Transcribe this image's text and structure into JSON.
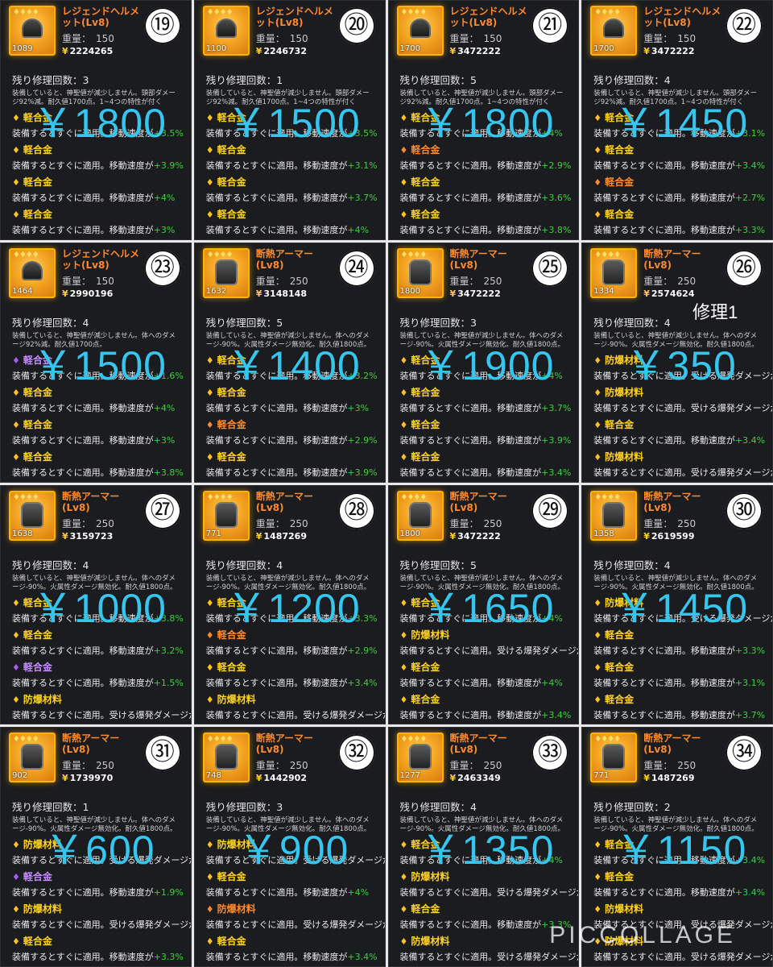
{
  "watermark": "PICCOLLAGE",
  "tiles": [
    {
      "num": "⑲",
      "name": "レジェンドヘルメット(Lv8)",
      "type": "helm",
      "stars": "♦♦♦♦",
      "dur": "1089",
      "weight_label": "重量：",
      "weight": "150",
      "price": "2224265",
      "repair": "残り修理回数：3",
      "desc": "装備していると、神聖値が減少しません。頭部ダメージ92%減。耐久値1700点。1~4つの特性が付く",
      "big": "￥1800",
      "stats": [
        {
          "n": "軽合金",
          "d": "装備するとすぐに適用。移動速度が",
          "v": "+3.5%",
          "c": "y"
        },
        {
          "n": "軽合金",
          "d": "装備するとすぐに適用。移動速度が",
          "v": "+3.9%",
          "c": "y"
        },
        {
          "n": "軽合金",
          "d": "装備するとすぐに適用。移動速度が",
          "v": "+4%",
          "c": "y"
        },
        {
          "n": "軽合金",
          "d": "装備するとすぐに適用。移動速度が",
          "v": "+3%",
          "c": "y"
        }
      ]
    },
    {
      "num": "⑳",
      "name": "レジェンドヘルメット(Lv8)",
      "type": "helm",
      "stars": "♦♦♦♦",
      "dur": "1100",
      "weight_label": "重量：",
      "weight": "150",
      "price": "2246732",
      "repair": "残り修理回数：1",
      "desc": "装備していると、神聖値が減少しません。頭部ダメージ92%減。耐久値1700点。1~4つの特性が付く",
      "big": "￥1500",
      "stats": [
        {
          "n": "軽合金",
          "d": "装備するとすぐに適用。移動速度が",
          "v": "+3.5%",
          "c": "y"
        },
        {
          "n": "軽合金",
          "d": "装備するとすぐに適用。移動速度が",
          "v": "+3.1%",
          "c": "y"
        },
        {
          "n": "軽合金",
          "d": "装備するとすぐに適用。移動速度が",
          "v": "+3.7%",
          "c": "y"
        },
        {
          "n": "軽合金",
          "d": "装備するとすぐに適用。移動速度が",
          "v": "+4%",
          "c": "y"
        }
      ]
    },
    {
      "num": "㉑",
      "name": "レジェンドヘルメット(Lv8)",
      "type": "helm",
      "stars": "♦♦♦♦",
      "dur": "1700",
      "weight_label": "重量：",
      "weight": "150",
      "price": "3472222",
      "repair": "残り修理回数：5",
      "desc": "装備していると、神聖値が減少しません。頭部ダメージ92%減。耐久値1700点。1~4つの特性が付く",
      "big": "￥1800",
      "stats": [
        {
          "n": "軽合金",
          "d": "装備するとすぐに適用。移動速度が",
          "v": "+4%",
          "c": "y"
        },
        {
          "n": "軽合金",
          "d": "装備するとすぐに適用。移動速度が",
          "v": "+2.9%",
          "c": "o"
        },
        {
          "n": "軽合金",
          "d": "装備するとすぐに適用。移動速度が",
          "v": "+3.6%",
          "c": "y"
        },
        {
          "n": "軽合金",
          "d": "装備するとすぐに適用。移動速度が",
          "v": "+3.8%",
          "c": "y"
        }
      ]
    },
    {
      "num": "㉒",
      "name": "レジェンドヘルメット(Lv8)",
      "type": "helm",
      "stars": "♦♦♦♦",
      "dur": "1700",
      "weight_label": "重量：",
      "weight": "150",
      "price": "3472222",
      "repair": "残り修理回数：4",
      "desc": "装備していると、神聖値が減少しません。頭部ダメージ92%減。耐久値1700点。1~4つの特性が付く",
      "big": "￥1450",
      "stats": [
        {
          "n": "軽合金",
          "d": "装備するとすぐに適用。移動速度が",
          "v": "+3.1%",
          "c": "y"
        },
        {
          "n": "軽合金",
          "d": "装備するとすぐに適用。移動速度が",
          "v": "+3.4%",
          "c": "y"
        },
        {
          "n": "軽合金",
          "d": "装備するとすぐに適用。移動速度が",
          "v": "+2.7%",
          "c": "o"
        },
        {
          "n": "軽合金",
          "d": "装備するとすぐに適用。移動速度が",
          "v": "+3.3%",
          "c": "y"
        }
      ]
    },
    {
      "num": "㉓",
      "name": "レジェンドヘルメット(Lv8)",
      "type": "helm",
      "stars": "♦♦♦♦",
      "dur": "1464",
      "weight_label": "重量：",
      "weight": "150",
      "price": "2990196",
      "repair": "残り修理回数：4",
      "desc": "装備していると、神聖値が減少しません。体へのダメージ92%減。耐久値1700点。",
      "big": "￥1500",
      "stats": [
        {
          "n": "軽合金",
          "d": "装備するとすぐに適用。移動速度が",
          "v": "+1.6%",
          "c": "p"
        },
        {
          "n": "軽合金",
          "d": "装備するとすぐに適用。移動速度が",
          "v": "+4%",
          "c": "y"
        },
        {
          "n": "軽合金",
          "d": "装備するとすぐに適用。移動速度が",
          "v": "+3%",
          "c": "y"
        },
        {
          "n": "軽合金",
          "d": "装備するとすぐに適用。移動速度が",
          "v": "+3.8%",
          "c": "y"
        }
      ]
    },
    {
      "num": "㉔",
      "name": "断熱アーマー(Lv8)",
      "type": "armor",
      "stars": "♦♦♦♦",
      "dur": "1632",
      "weight_label": "重量：",
      "weight": "250",
      "price": "3148148",
      "repair": "残り修理回数：5",
      "desc": "装備していると、神聖値が減少しません。体へのダメージ-90%。火属性ダメージ無効化。耐久値1800点。",
      "big": "￥1400",
      "stats": [
        {
          "n": "軽合金",
          "d": "装備するとすぐに適用。移動速度が",
          "v": "+3.2%",
          "c": "y"
        },
        {
          "n": "軽合金",
          "d": "装備するとすぐに適用。移動速度が",
          "v": "+3%",
          "c": "y"
        },
        {
          "n": "軽合金",
          "d": "装備するとすぐに適用。移動速度が",
          "v": "+2.9%",
          "c": "o"
        },
        {
          "n": "軽合金",
          "d": "装備するとすぐに適用。移動速度が",
          "v": "+3.9%",
          "c": "y"
        }
      ]
    },
    {
      "num": "㉕",
      "name": "断熱アーマー(Lv8)",
      "type": "armor",
      "stars": "♦♦♦♦",
      "dur": "1800",
      "weight_label": "重量：",
      "weight": "250",
      "price": "3472222",
      "repair": "残り修理回数：3",
      "desc": "装備していると、神聖値が減少しません。体へのダメージ-90%。火属性ダメージ無効化。耐久値1800点。",
      "big": "￥1900",
      "stats": [
        {
          "n": "軽合金",
          "d": "装備するとすぐに適用。移動速度が",
          "v": "+4%",
          "c": "y"
        },
        {
          "n": "軽合金",
          "d": "装備するとすぐに適用。移動速度が",
          "v": "+3.7%",
          "c": "y"
        },
        {
          "n": "軽合金",
          "d": "装備するとすぐに適用。移動速度が",
          "v": "+3.9%",
          "c": "y"
        },
        {
          "n": "軽合金",
          "d": "装備するとすぐに適用。移動速度が",
          "v": "+3.4%",
          "c": "y"
        }
      ]
    },
    {
      "num": "㉖",
      "name": "断熱アーマー(Lv8)",
      "type": "armor",
      "stars": "♦♦♦♦",
      "dur": "1334",
      "weight_label": "重量：",
      "weight": "250",
      "price": "2574624",
      "repair": "残り修理回数：4",
      "note": "修理1",
      "desc": "装備していると、神聖値が減少しません。体へのダメージ-90%。火属性ダメージ無効化。耐久値1800点。",
      "big": "￥350",
      "stats": [
        {
          "n": "防爆材料",
          "d": "装備するとすぐに適用。受ける爆発ダメージが",
          "v": "-19.2%",
          "c": "y"
        },
        {
          "n": "防爆材料",
          "d": "装備するとすぐに適用。受ける爆発ダメージが",
          "v": "-19.2%",
          "c": "y"
        },
        {
          "n": "軽合金",
          "d": "装備するとすぐに適用。移動速度が",
          "v": "+3.4%",
          "c": "y"
        },
        {
          "n": "防爆材料",
          "d": "装備するとすぐに適用。受ける爆発ダメージが",
          "v": "-25%",
          "c": "y"
        }
      ]
    },
    {
      "num": "㉗",
      "name": "断熱アーマー(Lv8)",
      "type": "armor",
      "stars": "♦♦♦♦",
      "dur": "1638",
      "weight_label": "重量：",
      "weight": "250",
      "price": "3159723",
      "repair": "残り修理回数：4",
      "desc": "装備していると、神聖値が減少しません。体へのダメージ-90%。火属性ダメージ無効化。耐久値1800点。",
      "big": "￥1000",
      "stats": [
        {
          "n": "軽合金",
          "d": "装備するとすぐに適用。移動速度が",
          "v": "+3.8%",
          "c": "y"
        },
        {
          "n": "軽合金",
          "d": "装備するとすぐに適用。移動速度が",
          "v": "+3.2%",
          "c": "y"
        },
        {
          "n": "軽合金",
          "d": "装備するとすぐに適用。移動速度が",
          "v": "+1.5%",
          "c": "p"
        },
        {
          "n": "防爆材料",
          "d": "装備するとすぐに適用。受ける爆発ダメージが",
          "v": "-18%",
          "c": "y"
        }
      ]
    },
    {
      "num": "㉘",
      "name": "断熱アーマー(Lv8)",
      "type": "armor",
      "stars": "♦♦♦♦",
      "dur": "771",
      "weight_label": "重量：",
      "weight": "250",
      "price": "1487269",
      "repair": "残り修理回数：4",
      "desc": "装備していると、神聖値が減少しません。体へのダメージ-90%。火属性ダメージ無効化。耐久値1800点。",
      "big": "￥1200",
      "stats": [
        {
          "n": "軽合金",
          "d": "装備するとすぐに適用。移動速度が",
          "v": "+3.3%",
          "c": "y"
        },
        {
          "n": "軽合金",
          "d": "装備するとすぐに適用。移動速度が",
          "v": "+2.9%",
          "c": "o"
        },
        {
          "n": "軽合金",
          "d": "装備するとすぐに適用。移動速度が",
          "v": "+3.4%",
          "c": "y"
        },
        {
          "n": "防爆材料",
          "d": "装備するとすぐに適用。受ける爆発ダメージが",
          "v": "-16%",
          "c": "y"
        }
      ]
    },
    {
      "num": "㉙",
      "name": "断熱アーマー(Lv8)",
      "type": "armor",
      "stars": "♦♦♦♦",
      "dur": "1800",
      "weight_label": "重量：",
      "weight": "250",
      "price": "3472222",
      "repair": "残り修理回数：5",
      "desc": "装備していると、神聖値が減少しません。体へのダメージ-90%。火属性ダメージ無効化。耐久値1800点。",
      "big": "￥1650",
      "stats": [
        {
          "n": "軽合金",
          "d": "装備するとすぐに適用。移動速度が",
          "v": "+4%",
          "c": "y"
        },
        {
          "n": "防爆材料",
          "d": "装備するとすぐに適用。受ける爆発ダメージが",
          "v": "-20%",
          "c": "y"
        },
        {
          "n": "軽合金",
          "d": "装備するとすぐに適用。移動速度が",
          "v": "+4%",
          "c": "y"
        },
        {
          "n": "軽合金",
          "d": "装備するとすぐに適用。移動速度が",
          "v": "+3.4%",
          "c": "y"
        }
      ]
    },
    {
      "num": "㉚",
      "name": "断熱アーマー(Lv8)",
      "type": "armor",
      "stars": "♦♦♦♦",
      "dur": "1358",
      "weight_label": "重量：",
      "weight": "250",
      "price": "2619599",
      "repair": "残り修理回数：4",
      "desc": "装備していると、神聖値が減少しません。体へのダメージ-90%。火属性ダメージ無効化。耐久値1800点。",
      "big": "￥1450",
      "stats": [
        {
          "n": "防爆材料",
          "d": "装備するとすぐに適用。受ける爆発ダメージが",
          "v": "-17.2%",
          "c": "y"
        },
        {
          "n": "軽合金",
          "d": "装備するとすぐに適用。移動速度が",
          "v": "+3.3%",
          "c": "y"
        },
        {
          "n": "軽合金",
          "d": "装備するとすぐに適用。移動速度が",
          "v": "+3.1%",
          "c": "y"
        },
        {
          "n": "軽合金",
          "d": "装備するとすぐに適用。移動速度が",
          "v": "+3.7%",
          "c": "y"
        }
      ]
    },
    {
      "num": "㉛",
      "name": "断熱アーマー(Lv8)",
      "type": "armor",
      "stars": "♦♦♦♦",
      "dur": "902",
      "weight_label": "重量：",
      "weight": "250",
      "price": "1739970",
      "repair": "残り修理回数：1",
      "desc": "装備していると、神聖値が減少しません。体へのダメージ-90%。火属性ダメージ無効化。耐久値1800点。",
      "big": "￥600",
      "stats": [
        {
          "n": "防爆材料",
          "d": "装備するとすぐに適用。受ける爆発ダメージが",
          "v": "-18.4%",
          "c": "y"
        },
        {
          "n": "軽合金",
          "d": "装備するとすぐに適用。移動速度が",
          "v": "+1.9%",
          "c": "p"
        },
        {
          "n": "防爆材料",
          "d": "装備するとすぐに適用。受ける爆発ダメージが",
          "v": "-16.4%",
          "c": "y"
        },
        {
          "n": "軽合金",
          "d": "装備するとすぐに適用。移動速度が",
          "v": "+3.3%",
          "c": "y"
        }
      ]
    },
    {
      "num": "㉜",
      "name": "断熱アーマー(Lv8)",
      "type": "armor",
      "stars": "♦♦♦♦",
      "dur": "748",
      "weight_label": "重量：",
      "weight": "250",
      "price": "1442902",
      "repair": "残り修理回数：3",
      "desc": "装備していると、神聖値が減少しません。体へのダメージ-90%。火属性ダメージ無効化。耐久値1800点。",
      "big": "￥900",
      "stats": [
        {
          "n": "防爆材料",
          "d": "装備するとすぐに適用。受ける爆発ダメージが",
          "v": "-17.2%",
          "c": "y"
        },
        {
          "n": "軽合金",
          "d": "装備するとすぐに適用。移動速度が",
          "v": "+4%",
          "c": "y"
        },
        {
          "n": "防爆材料",
          "d": "装備するとすぐに適用。受ける爆発ダメージが",
          "v": "-10.8%",
          "c": "o"
        },
        {
          "n": "軽合金",
          "d": "装備するとすぐに適用。移動速度が",
          "v": "+3.4%",
          "c": "y"
        }
      ]
    },
    {
      "num": "㉝",
      "name": "断熱アーマー(Lv8)",
      "type": "armor",
      "stars": "♦♦♦♦",
      "dur": "1277",
      "weight_label": "重量：",
      "weight": "250",
      "price": "2463349",
      "repair": "残り修理回数：4",
      "desc": "装備していると、神聖値が減少しません。体へのダメージ-90%。火属性ダメージ無効化。耐久値1800点。",
      "big": "￥1350",
      "stats": [
        {
          "n": "軽合金",
          "d": "装備するとすぐに適用。移動速度が",
          "v": "+4%",
          "c": "y"
        },
        {
          "n": "防爆材料",
          "d": "装備するとすぐに適用。受ける爆発ダメージが",
          "v": "-15.2%",
          "c": "y"
        },
        {
          "n": "軽合金",
          "d": "装備するとすぐに適用。移動速度が",
          "v": "+3.3%",
          "c": "y"
        },
        {
          "n": "防爆材料",
          "d": "装備するとすぐに適用。受ける爆発ダメージが",
          "v": "-15.6%",
          "c": "y"
        }
      ]
    },
    {
      "num": "㉞",
      "name": "断熱アーマー(Lv8)",
      "type": "armor",
      "stars": "♦♦♦♦",
      "dur": "771",
      "weight_label": "重量：",
      "weight": "250",
      "price": "1487269",
      "repair": "残り修理回数：2",
      "desc": "装備していると、神聖値が減少しません。体へのダメージ-90%。火属性ダメージ無効化。耐久値1800点。",
      "big": "￥1150",
      "stats": [
        {
          "n": "軽合金",
          "d": "装備するとすぐに適用。移動速度が",
          "v": "+3.4%",
          "c": "y"
        },
        {
          "n": "軽合金",
          "d": "装備するとすぐに適用。移動速度が",
          "v": "+3.4%",
          "c": "y"
        },
        {
          "n": "防爆材料",
          "d": "装備するとすぐに適用。受ける爆発ダメージが",
          "v": "-19.6%",
          "c": "y"
        },
        {
          "n": "防爆材料",
          "d": "装備するとすぐに適用。受ける爆発ダメージが",
          "v": "-16.8%",
          "c": "y"
        }
      ]
    }
  ]
}
